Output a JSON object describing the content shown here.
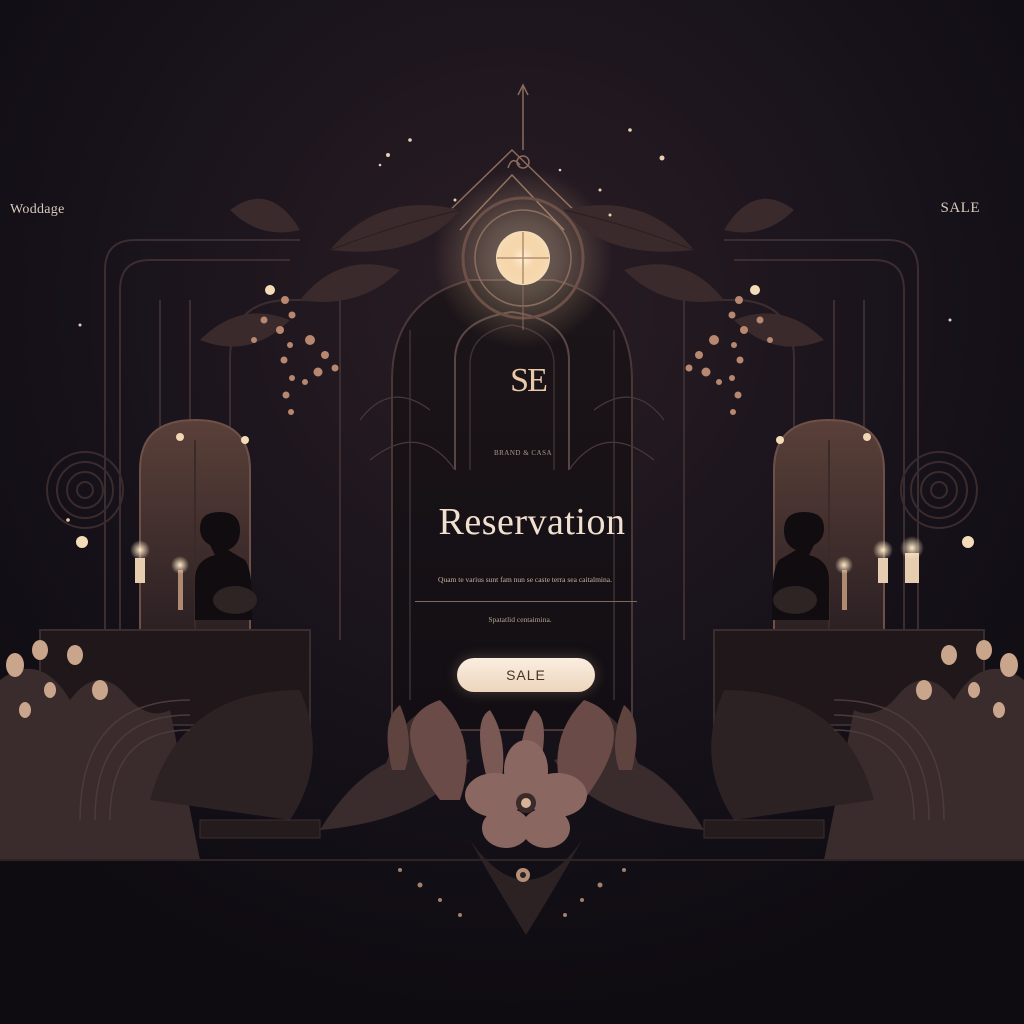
{
  "header": {
    "brand_label": "Woddage",
    "sale_link": "SALE"
  },
  "hero": {
    "monogram": "SE",
    "tagline": "BRAND & CASA",
    "title": "Reservation",
    "subtitle": "Quam te varius sunt fam nun se caste terra sea caitalmina.",
    "caption": "Spatatlid centaimina.",
    "cta_label": "SALE"
  },
  "colors": {
    "background": "#130f16",
    "accent_gold": "#e8c9a9",
    "foliage": "#3a2a2a",
    "button_fill": "#f5e3d0"
  }
}
